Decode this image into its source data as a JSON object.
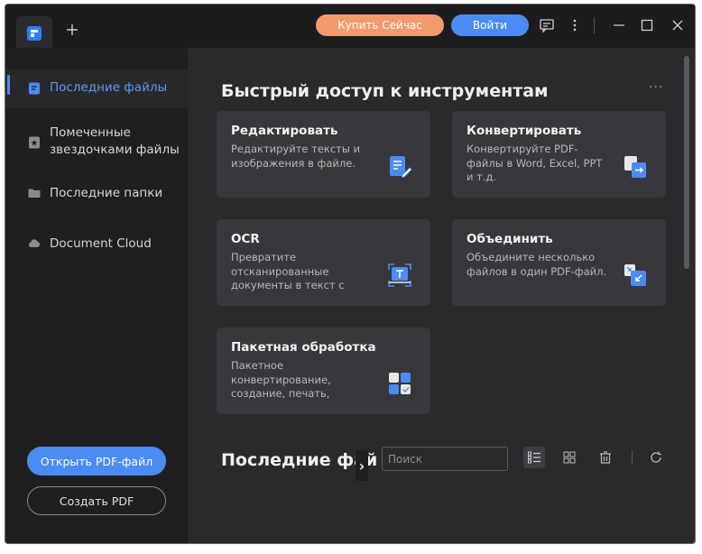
{
  "titlebar": {
    "buy_label": "Купить Сейчас",
    "login_label": "Войти"
  },
  "sidebar": {
    "items": [
      {
        "label": "Последние файлы",
        "icon": "recent-files-icon",
        "active": true
      },
      {
        "label": "Помеченные звездочками файлы",
        "icon": "starred-files-icon",
        "active": false
      },
      {
        "label": "Последние папки",
        "icon": "folder-icon",
        "active": false
      },
      {
        "label": "Document Cloud",
        "icon": "cloud-icon",
        "active": false
      }
    ],
    "open_pdf_label": "Открыть PDF-файл",
    "create_pdf_label": "Создать PDF"
  },
  "main": {
    "quick_access_title": "Быстрый доступ к инструментам",
    "more_label": "···",
    "cards": [
      {
        "title": "Редактировать",
        "desc": "Редактируйте тексты и изображения в файле.",
        "icon": "edit-document-icon"
      },
      {
        "title": "Конвертировать",
        "desc": "Конвертируйте PDF-файлы в Word, Excel, PPT и т.д.",
        "icon": "convert-icon"
      },
      {
        "title": "OCR",
        "desc": "Превратите отсканированные документы в текст с возм...",
        "icon": "ocr-scan-icon"
      },
      {
        "title": "Объединить",
        "desc": "Объедините несколько файлов в один PDF-файл.",
        "icon": "merge-icon"
      },
      {
        "title": "Пакетная обработка",
        "desc": "Пакетное конвертирование, создание, печать, распозн...",
        "icon": "batch-grid-icon"
      }
    ],
    "recent_title": "Последние фай",
    "recent_arrow": "›",
    "search_placeholder": "Поиск"
  },
  "colors": {
    "accent": "#4a8cf2",
    "buy": "#f29a6e",
    "background": "#2a2a2d",
    "card": "#38383c"
  }
}
